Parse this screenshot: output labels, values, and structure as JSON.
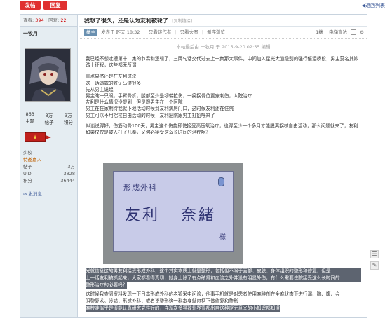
{
  "toolbar": {
    "post_label": "发帖",
    "reply_label": "回复",
    "back_label": "◀返回列表"
  },
  "sidebar": {
    "stats": {
      "views_label": "查看:",
      "views": "394",
      "replies_label": "回复:",
      "replies": "22"
    },
    "username": "一牧月",
    "counts": [
      {
        "value": "863",
        "label": "主题"
      },
      {
        "value": "3万",
        "label": "帖子"
      },
      {
        "value": "3万",
        "label": "积分"
      }
    ],
    "rank": "少校",
    "group": "特邀嘉人",
    "info": [
      {
        "key": "帖子",
        "value": "3万"
      },
      {
        "key": "UID",
        "value": "3828"
      },
      {
        "key": "积分",
        "value": "36444"
      }
    ],
    "message_label": "发消息"
  },
  "post": {
    "title": "我想了很久，还是认为友利被轮了",
    "copy_link": "[复制链接]",
    "op_tag": "楼主",
    "posted_at": "发表于 昨天 18:32",
    "only_author": "只看该作者",
    "reverse": "只看大图",
    "reverse2": "倒序浏览",
    "floor": "1楼",
    "jump_label": "电梯直达",
    "edit_note": "本帖最后由 一牧月 于 2015-9-20 02:55 编辑",
    "paragraph1": "我已经不想吐槽第十二集的节奏和逻辑了，三两句话交代过去上一集那大事件，中间加入星光大道级别的强行催泪桥段，男主莫名其妙踏上征程，这些都无所谓",
    "list_lines": [
      "重点果然还是在友利这块",
      "这一话透露的铁证马迹很多",
      "先从男主说起",
      "男主瞎一只眼，手臂骨折，腿部至少是韧带拉伤，一瘸拐骨位置穿刺伤，入院治疗",
      "友利是什么情况没提到，但是跟男主在一个医院",
      "男主在在家期待我就下地活动时候到友利病房门口，这时候友利还在住院",
      "男主可以不用拐杖自由活动的时候，友利出院跟男主打招呼来了"
    ],
    "paragraph3": "似谈说得好，伤筋动骨100天，男主这个伤势即使接受高压氧治疗，也得至少一个多月才能脱离拐杖自由活动，那么问题就来了，友利如果仅仅是被人打了几拳，又何必接受这么长时间的治疗呢？",
    "image_card": {
      "small_text": "形成外科",
      "name_part1": "友利",
      "name_part2": "奈緒",
      "honorific": "様"
    },
    "highlight_lines": [
      "光就信息这的男友利接受形成外科，这个其实本质上就是整形，包括但不限于面部、皮肤、身体组织的整形和修复，但是",
      "上一话友利被抓起来，大家都看得真切，她身上除了有点破肾和血流之外并没有明显外伤，有什么需要住院接受这么长时间的",
      "整形治疗的必要吗？",
      "这时候我查阅资料发现一下日本形成外科的老鸨采中问诊，他事手机就是对患者使用麻醉剂在全麻状态下进行漏、胸、腹、会",
      "阴整复术。没错，形成外科，或者说整形这一科本身就包括下体修复和整形",
      "麻枝准似乎是很能认真研究党性好的，连现次多导致外界雪都出自这种逻无意义的小知识都知道"
    ]
  },
  "float_icons": [
    "comment-icon",
    "edit-icon"
  ]
}
